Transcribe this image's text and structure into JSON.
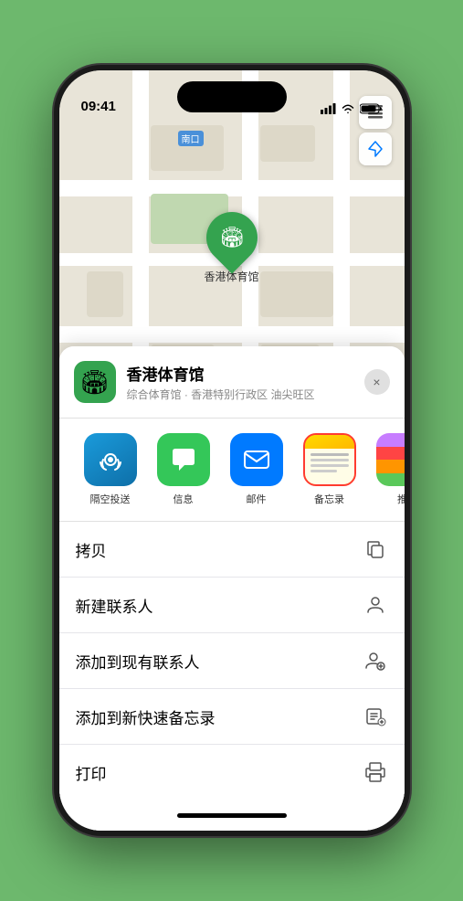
{
  "phone": {
    "status_bar": {
      "time": "09:41",
      "signal_label": "signal bars",
      "wifi_label": "wifi",
      "battery_label": "battery"
    },
    "map": {
      "label_text": "南口",
      "pin_venue": "香港体育馆",
      "map_type_icon": "map-layers-icon",
      "location_icon": "location-arrow-icon"
    },
    "venue_card": {
      "name": "香港体育馆",
      "subtitle": "综合体育馆 · 香港特别行政区 油尖旺区",
      "close_label": "×"
    },
    "apps": [
      {
        "id": "airdrop",
        "label": "隔空投送",
        "selected": false
      },
      {
        "id": "messages",
        "label": "信息",
        "selected": false
      },
      {
        "id": "mail",
        "label": "邮件",
        "selected": false
      },
      {
        "id": "notes",
        "label": "备忘录",
        "selected": true
      },
      {
        "id": "more",
        "label": "推",
        "selected": false
      }
    ],
    "actions": [
      {
        "id": "copy",
        "label": "拷贝",
        "icon": "copy-icon"
      },
      {
        "id": "new-contact",
        "label": "新建联系人",
        "icon": "new-contact-icon"
      },
      {
        "id": "add-existing",
        "label": "添加到现有联系人",
        "icon": "add-contact-icon"
      },
      {
        "id": "quick-note",
        "label": "添加到新快速备忘录",
        "icon": "quick-note-icon"
      },
      {
        "id": "print",
        "label": "打印",
        "icon": "print-icon"
      }
    ]
  }
}
